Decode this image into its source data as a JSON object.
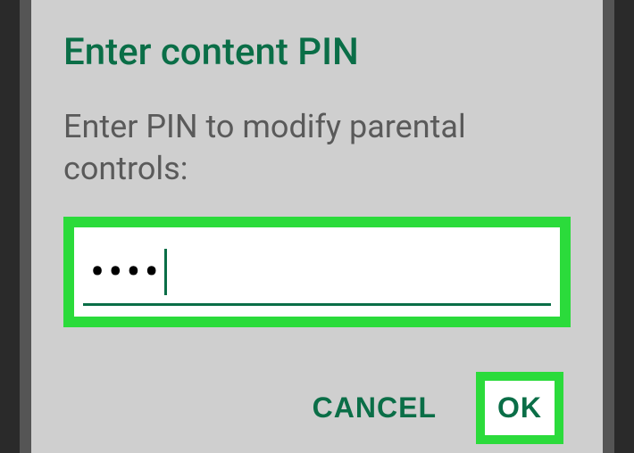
{
  "dialog": {
    "title": "Enter content PIN",
    "subtitle": "Enter PIN to modify parental controls:",
    "pin_masked": "••••",
    "cancel_label": "CANCEL",
    "ok_label": "OK"
  },
  "colors": {
    "accent": "#0a6e47",
    "highlight": "#2bdb3b"
  }
}
